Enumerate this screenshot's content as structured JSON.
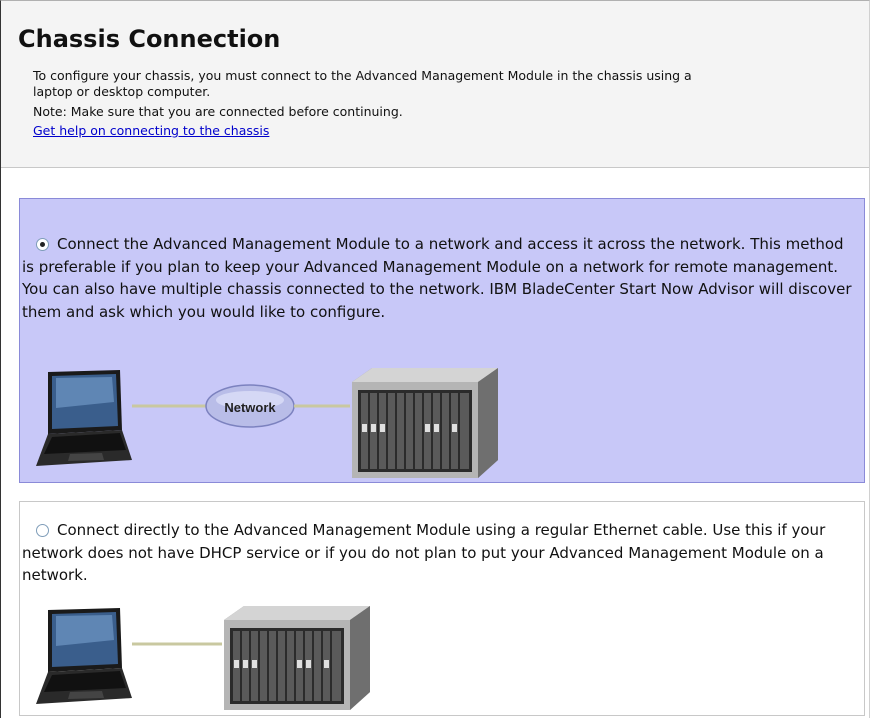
{
  "header": {
    "title": "Chassis Connection",
    "description_line1": "To configure your chassis, you must connect to the Advanced Management Module in the chassis using a",
    "description_line2": "laptop or desktop computer.",
    "note": "Note: Make sure that you are connected before continuing.",
    "help_link": "Get help on connecting to the chassis"
  },
  "options": [
    {
      "selected": true,
      "text": "Connect the Advanced Management Module to a network and access it across the network. This method is preferable if you plan to keep your Advanced Management Module on a network for remote management. You can also have multiple chassis connected to the network. IBM BladeCenter Start Now Advisor will discover them and ask which you would like to configure.",
      "illustration_label": "Network"
    },
    {
      "selected": false,
      "text": "Connect directly to the Advanced Management Module using a regular Ethernet cable. Use this if your network does not have DHCP service or if you do not plan to put your Advanced Management Module on a network."
    }
  ],
  "colors": {
    "selected_option_bg": "#c8c8f8",
    "link": "#0000cc",
    "header_bg": "#f4f4f4"
  }
}
